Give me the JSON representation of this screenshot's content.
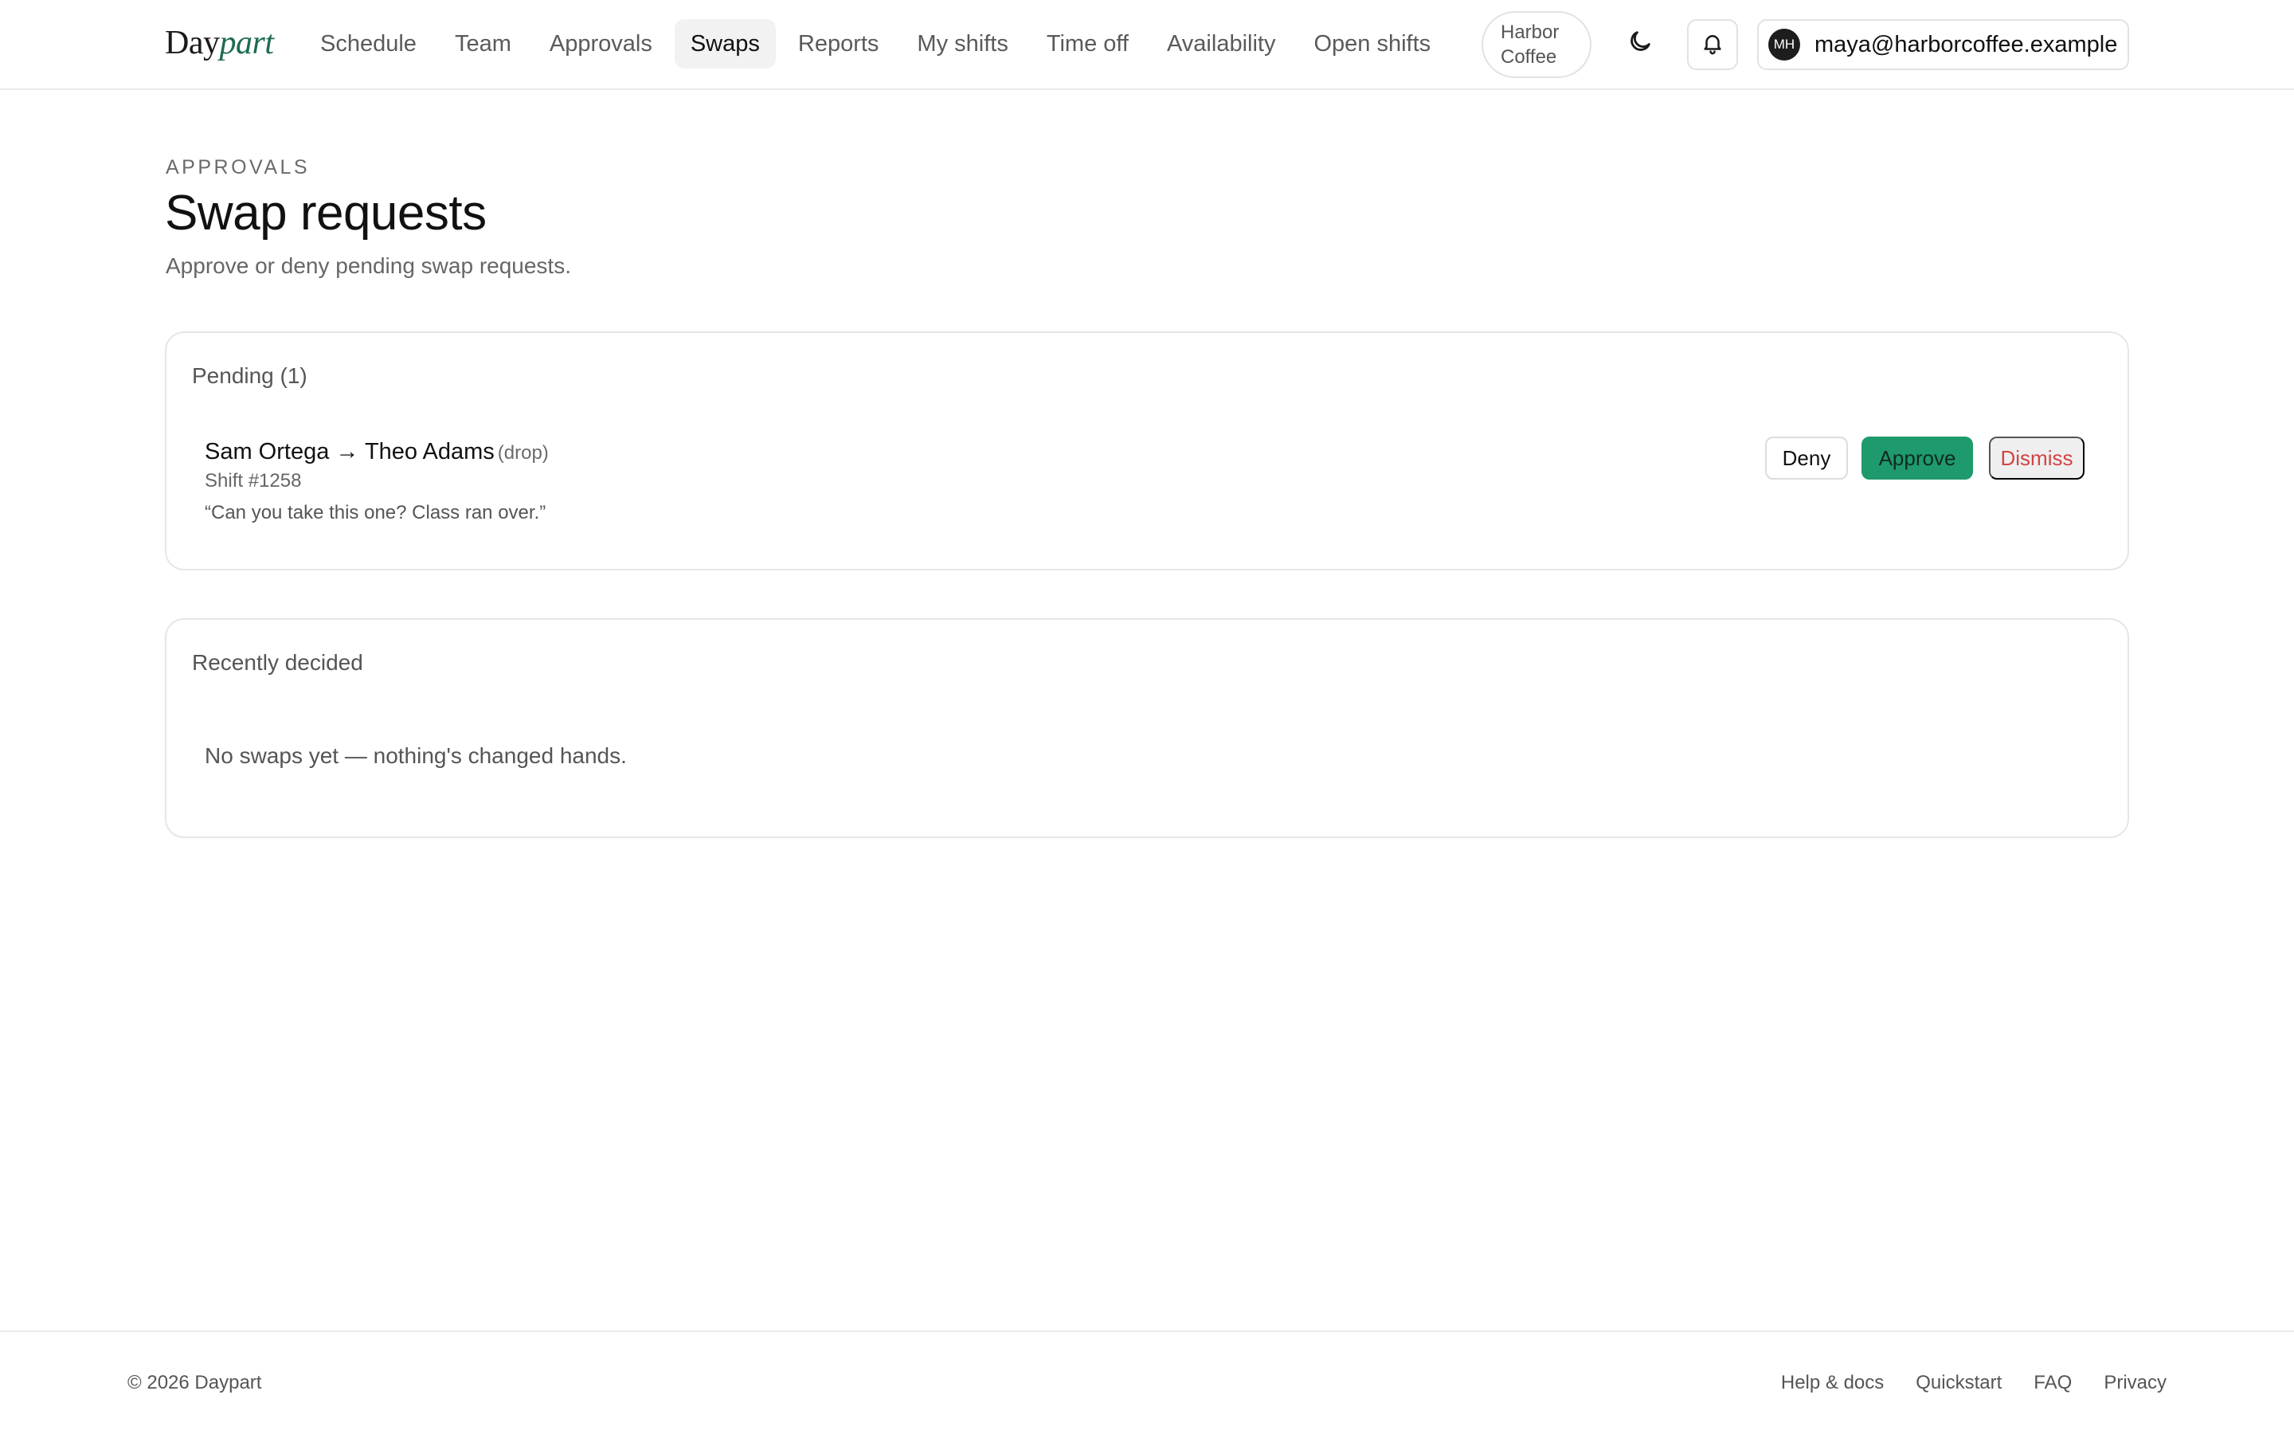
{
  "brand": {
    "logo_prefix": "Day",
    "logo_suffix": "part"
  },
  "nav": {
    "items": [
      {
        "label": "Schedule",
        "active": false
      },
      {
        "label": "Team",
        "active": false
      },
      {
        "label": "Approvals",
        "active": false
      },
      {
        "label": "Swaps",
        "active": true
      },
      {
        "label": "Reports",
        "active": false
      },
      {
        "label": "My shifts",
        "active": false
      },
      {
        "label": "Time off",
        "active": false
      },
      {
        "label": "Availability",
        "active": false
      },
      {
        "label": "Open shifts",
        "active": false
      }
    ]
  },
  "org": {
    "line1": "Harbor",
    "line2": "Coffee"
  },
  "account": {
    "initials": "MH",
    "email": "maya@harborcoffee.example"
  },
  "header": {
    "eyebrow": "Approvals",
    "title": "Swap requests",
    "subtitle": "Approve or deny pending swap requests."
  },
  "pending": {
    "title": "Pending (1)",
    "requests": [
      {
        "from": "Sam Ortega",
        "arrow": "→",
        "to": "Theo Adams",
        "type": "(drop)",
        "shift": "Shift #1258",
        "note": "“Can you take this one? Class ran over.”"
      }
    ],
    "actions": {
      "deny": "Deny",
      "approve": "Approve",
      "dismiss": "Dismiss"
    }
  },
  "recent": {
    "title": "Recently decided",
    "empty": "No swaps yet — nothing's changed hands."
  },
  "footer": {
    "copyright": "© 2026 Daypart",
    "links": [
      "Help & docs",
      "Quickstart",
      "FAQ",
      "Privacy"
    ]
  },
  "colors": {
    "approve": "#1e9a6c",
    "dismiss": "#d24444",
    "brand_accent": "#1f6b4f",
    "active_nav_bg": "#f2f2f2"
  }
}
